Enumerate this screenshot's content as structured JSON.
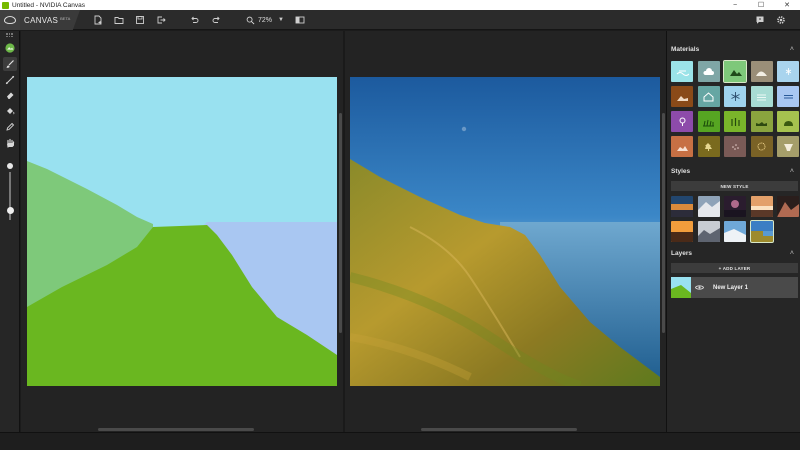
{
  "window": {
    "title": "Untitled - NVIDIA Canvas",
    "minimize": "−",
    "maximize": "☐",
    "close": "✕"
  },
  "brand": {
    "name": "CANVAS",
    "badge": "BETA"
  },
  "toolbar": {
    "zoom": "72%",
    "buttons": [
      "new-file-icon",
      "open-folder-icon",
      "save-icon",
      "export-icon",
      "undo-icon",
      "redo-icon",
      "zoom-icon",
      "split-view-icon",
      "chat-feedback-icon",
      "gear-icon"
    ]
  },
  "tools": [
    "material-brush-icon",
    "brush-icon",
    "line-icon",
    "eraser-icon",
    "fill-bucket-icon",
    "eyedropper-icon",
    "hand-pan-icon"
  ],
  "brush": {
    "size_level": 0.2
  },
  "panel": {
    "materials_title": "Materials",
    "styles_title": "Styles",
    "new_style": "NEW STYLE",
    "layers_title": "Layers",
    "add_layer": "+ ADD LAYER",
    "collapse": "˄"
  },
  "materials": [
    {
      "name": "sky-icon",
      "color": "#9be3e8"
    },
    {
      "name": "cloud-icon",
      "color": "#7fa6a6"
    },
    {
      "name": "mountain-icon",
      "color": "#7ec87a",
      "selected": true
    },
    {
      "name": "hill-icon",
      "color": "#9a8e78"
    },
    {
      "name": "snow-icon",
      "color": "#a9d4ee"
    },
    {
      "name": "dirt-icon",
      "color": "#8a4a18"
    },
    {
      "name": "house-icon",
      "color": "#66a6a3"
    },
    {
      "name": "snowflake-icon",
      "color": "#9fd3ee"
    },
    {
      "name": "fog-icon",
      "color": "#a8dcd4"
    },
    {
      "name": "water-icon",
      "color": "#a9c7f2"
    },
    {
      "name": "flower-icon",
      "color": "#8d4baa"
    },
    {
      "name": "grass-icon",
      "color": "#56a522"
    },
    {
      "name": "tall-grass-icon",
      "color": "#7ab52a"
    },
    {
      "name": "field-icon",
      "color": "#8aa43e"
    },
    {
      "name": "bush-icon",
      "color": "#a6c24f"
    },
    {
      "name": "rock-icon",
      "color": "#c77044"
    },
    {
      "name": "tree-icon",
      "color": "#7a6a1e"
    },
    {
      "name": "gravel-icon",
      "color": "#7a5a56"
    },
    {
      "name": "sand-icon",
      "color": "#7a6226"
    },
    {
      "name": "stone-icon",
      "color": "#a59e6a"
    }
  ],
  "layers": [
    {
      "name": "New Layer 1"
    }
  ]
}
